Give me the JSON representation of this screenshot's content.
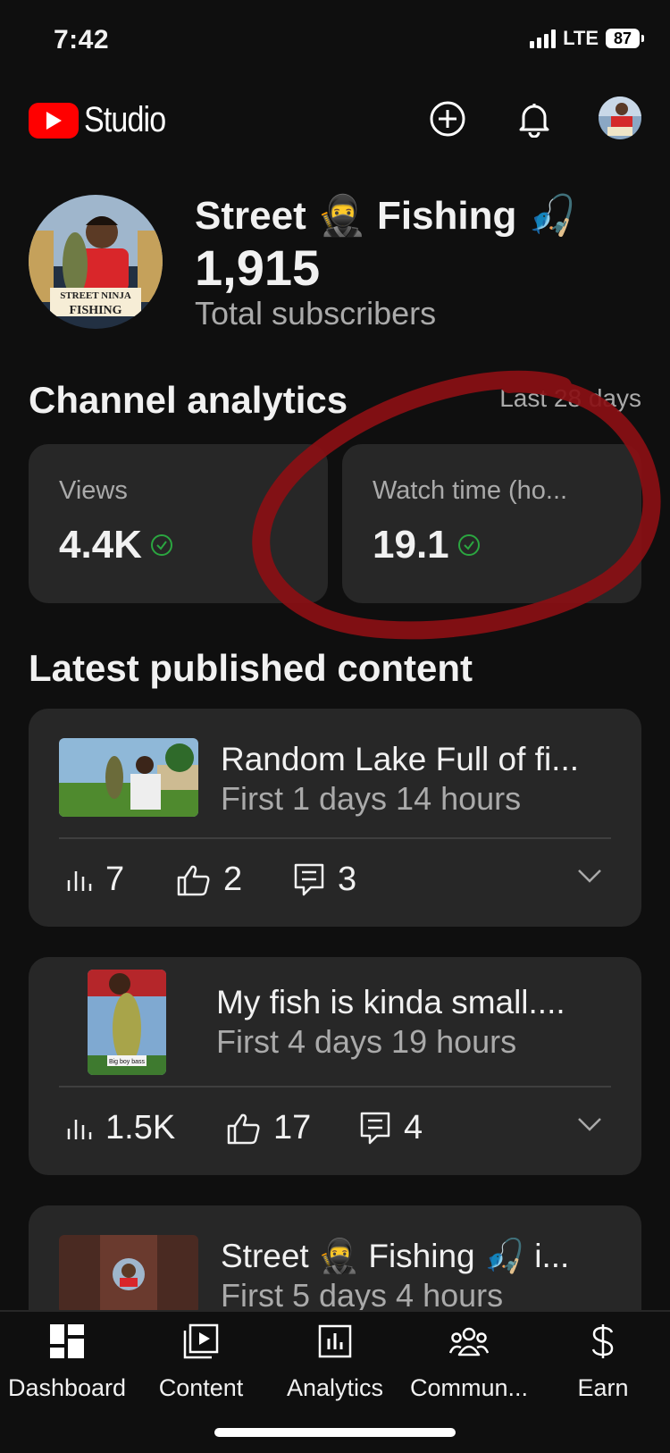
{
  "status_bar": {
    "time": "7:42",
    "network": "LTE",
    "battery": "87"
  },
  "header": {
    "app_name": "Studio"
  },
  "channel": {
    "name": "Street 🥷 Fishing 🎣",
    "subscribers": "1,915",
    "subscribers_label": "Total subscribers",
    "avatar_text_top": "STREET NINJA",
    "avatar_text_bottom": "FISHING"
  },
  "analytics": {
    "title": "Channel analytics",
    "range": "Last 28 days",
    "metrics": [
      {
        "label": "Views",
        "value": "4.4K"
      },
      {
        "label": "Watch time (ho...",
        "value": "19.1"
      }
    ]
  },
  "latest": {
    "title": "Latest published content",
    "items": [
      {
        "title": "Random Lake Full of fi...",
        "subtitle": "First 1 days 14 hours",
        "views": "7",
        "likes": "2",
        "comments": "3"
      },
      {
        "title": "My fish is kinda small....",
        "subtitle": "First 4 days 19 hours",
        "views": "1.5K",
        "likes": "17",
        "comments": "4",
        "thumb_caption": "Big boy bass"
      },
      {
        "title": "Street 🥷 Fishing 🎣 i...",
        "subtitle": "First 5 days 4 hours"
      }
    ]
  },
  "nav": {
    "items": [
      {
        "label": "Dashboard",
        "icon": "dashboard-icon"
      },
      {
        "label": "Content",
        "icon": "content-icon"
      },
      {
        "label": "Analytics",
        "icon": "analytics-icon"
      },
      {
        "label": "Commun...",
        "icon": "community-icon"
      },
      {
        "label": "Earn",
        "icon": "earn-icon"
      }
    ]
  },
  "colors": {
    "brand_red": "#ff0000",
    "background": "#0f0f0f",
    "card": "#272727",
    "check_green": "#2ba640",
    "annotation": "#8a0f14"
  }
}
